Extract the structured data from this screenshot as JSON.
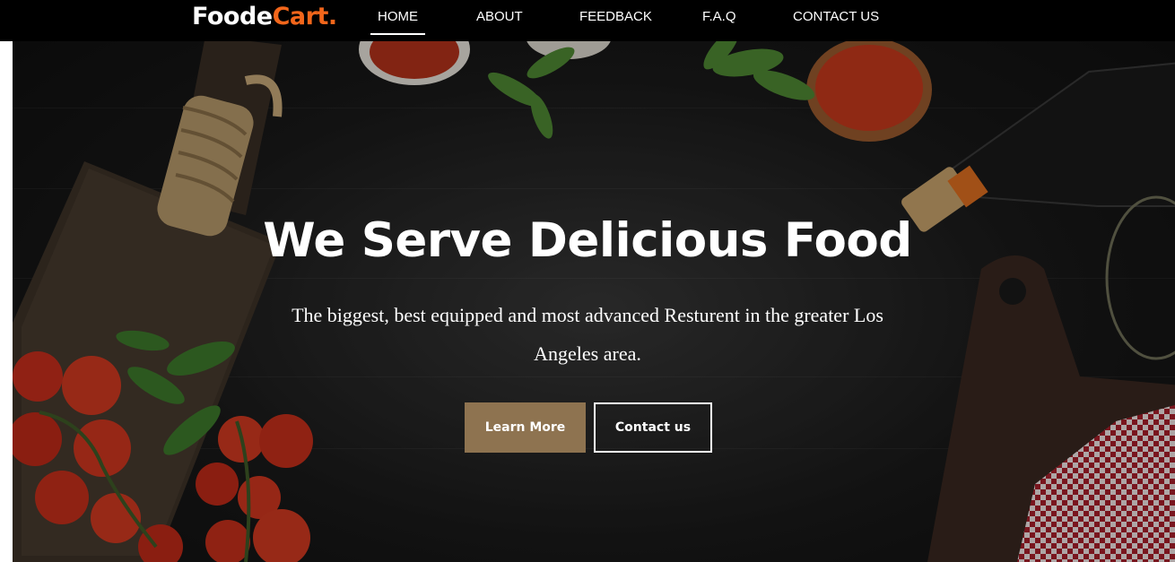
{
  "nav": {
    "logo_main": "Foode",
    "logo_accent": "Cart.",
    "links": [
      "HOME",
      "ABOUT",
      "FEEDBACK",
      "F.A.Q",
      "CONTACT US"
    ],
    "active_index": 0
  },
  "hero": {
    "headline": "We Serve Delicious Food",
    "subtitle": "The biggest, best equipped and most advanced Resturent in the greater Los Angeles area.",
    "buttons": {
      "learn_more": "Learn More",
      "contact_us": "Contact us"
    }
  },
  "colors": {
    "accent": "#f2661b",
    "button_primary": "#8e7350",
    "navbar": "#000000"
  }
}
